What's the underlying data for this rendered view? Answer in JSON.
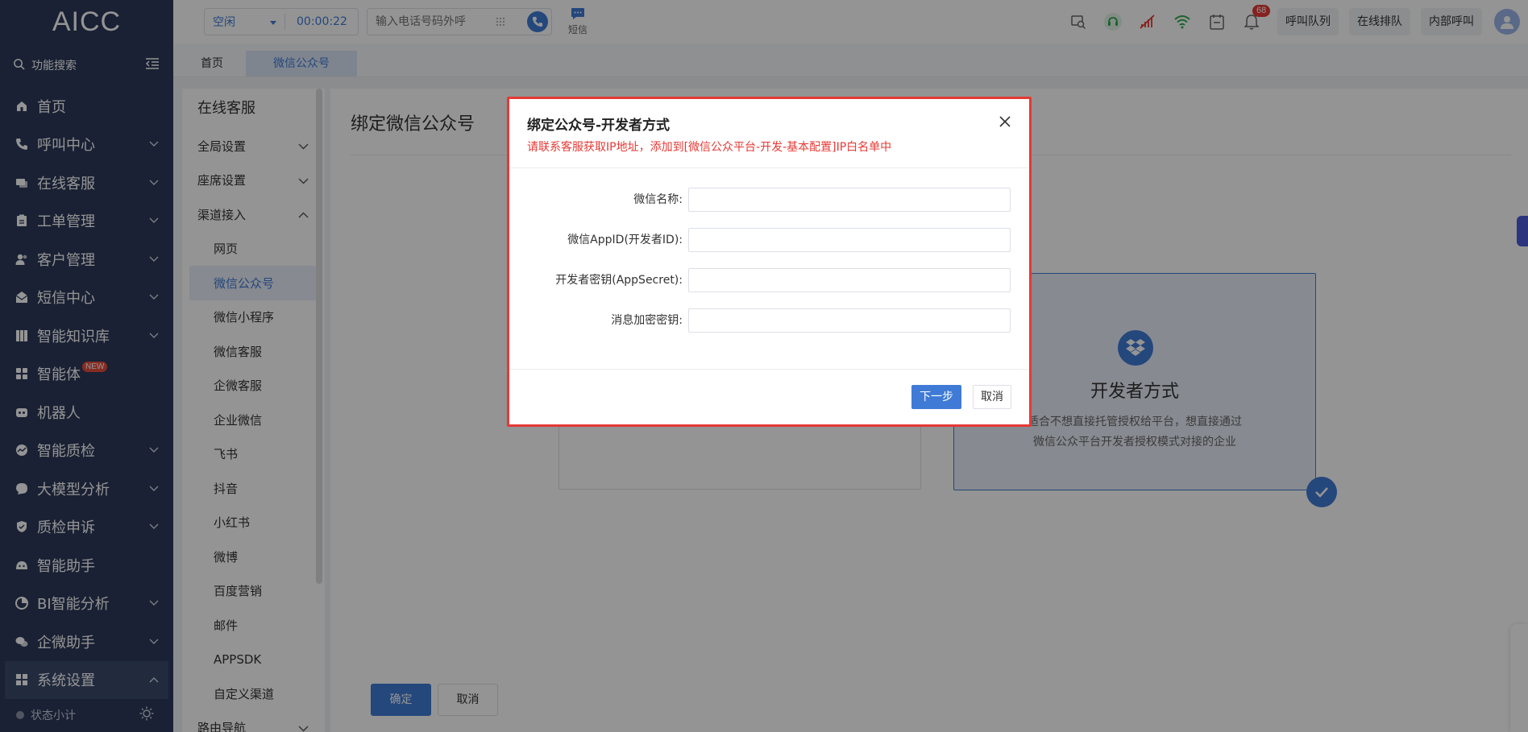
{
  "app": {
    "logo": "AICC"
  },
  "sidebar": {
    "search_label": "功能搜索",
    "items": [
      {
        "label": "首页",
        "icon": "home-icon",
        "has_arrow": false
      },
      {
        "label": "呼叫中心",
        "icon": "phone-icon",
        "has_arrow": true
      },
      {
        "label": "在线客服",
        "icon": "chat-icon",
        "has_arrow": true
      },
      {
        "label": "工单管理",
        "icon": "clipboard-icon",
        "has_arrow": true
      },
      {
        "label": "客户管理",
        "icon": "users-icon",
        "has_arrow": true
      },
      {
        "label": "短信中心",
        "icon": "mail-icon",
        "has_arrow": true
      },
      {
        "label": "智能知识库",
        "icon": "grid-icon",
        "has_arrow": true
      },
      {
        "label": "智能体",
        "icon": "apps-icon",
        "has_arrow": false,
        "badge": "NEW"
      },
      {
        "label": "机器人",
        "icon": "robot-icon",
        "has_arrow": false
      },
      {
        "label": "智能质检",
        "icon": "gauge-icon",
        "has_arrow": true
      },
      {
        "label": "大模型分析",
        "icon": "bubble-icon",
        "has_arrow": true
      },
      {
        "label": "质检申诉",
        "icon": "shield-icon",
        "has_arrow": true
      },
      {
        "label": "智能助手",
        "icon": "assistant-icon",
        "has_arrow": false
      },
      {
        "label": "BI智能分析",
        "icon": "chart-icon",
        "has_arrow": true
      },
      {
        "label": "企微助手",
        "icon": "wechat-icon",
        "has_arrow": true
      },
      {
        "label": "系统设置",
        "icon": "settings-grid-icon",
        "has_arrow": true,
        "active": true
      }
    ],
    "bottom_label": "状态小计"
  },
  "header": {
    "agent_state": "空闲",
    "timer": "00:00:22",
    "dial_placeholder": "输入电话号码外呼",
    "sms_label": "短信",
    "notification_count": "68",
    "buttons": [
      "呼叫队列",
      "在线排队",
      "内部呼叫"
    ]
  },
  "tabs": [
    {
      "label": "首页",
      "active": false
    },
    {
      "label": "微信公众号",
      "active": true
    }
  ],
  "submenu": {
    "title": "在线客服",
    "groups": [
      {
        "label": "全局设置",
        "expanded": false
      },
      {
        "label": "座席设置",
        "expanded": false
      },
      {
        "label": "渠道接入",
        "expanded": true
      }
    ],
    "channels": [
      "网页",
      "微信公众号",
      "微信小程序",
      "微信客服",
      "企微客服",
      "企业微信",
      "飞书",
      "抖音",
      "小红书",
      "微博",
      "百度营销",
      "邮件",
      "APPSDK",
      "自定义渠道"
    ],
    "active_channel": "微信公众号",
    "last_group": "路由导航"
  },
  "content": {
    "page_title": "绑定微信公众号",
    "card_right": {
      "title": "开发者方式",
      "desc_line1": "适合不想直接托管授权给平台，想直接通过",
      "desc_line2": "微信公众平台开发者授权模式对接的企业"
    },
    "ok_label": "确定",
    "cancel_label": "取消"
  },
  "modal": {
    "title": "绑定公众号-开发者方式",
    "notice": "请联系客服获取IP地址，添加到[微信公众平台-开发-基本配置]IP白名单中",
    "fields": [
      {
        "label": "微信名称:",
        "value": ""
      },
      {
        "label": "微信AppID(开发者ID):",
        "value": ""
      },
      {
        "label": "开发者密钥(AppSecret):",
        "value": ""
      },
      {
        "label": "消息加密密钥:",
        "value": ""
      }
    ],
    "next_label": "下一步",
    "cancel_label": "取消"
  },
  "colors": {
    "sidebar_bg": "#2d3a5a",
    "accent": "#3f7bd6",
    "highlight_border": "#e53935",
    "notice_text": "#e53935"
  }
}
